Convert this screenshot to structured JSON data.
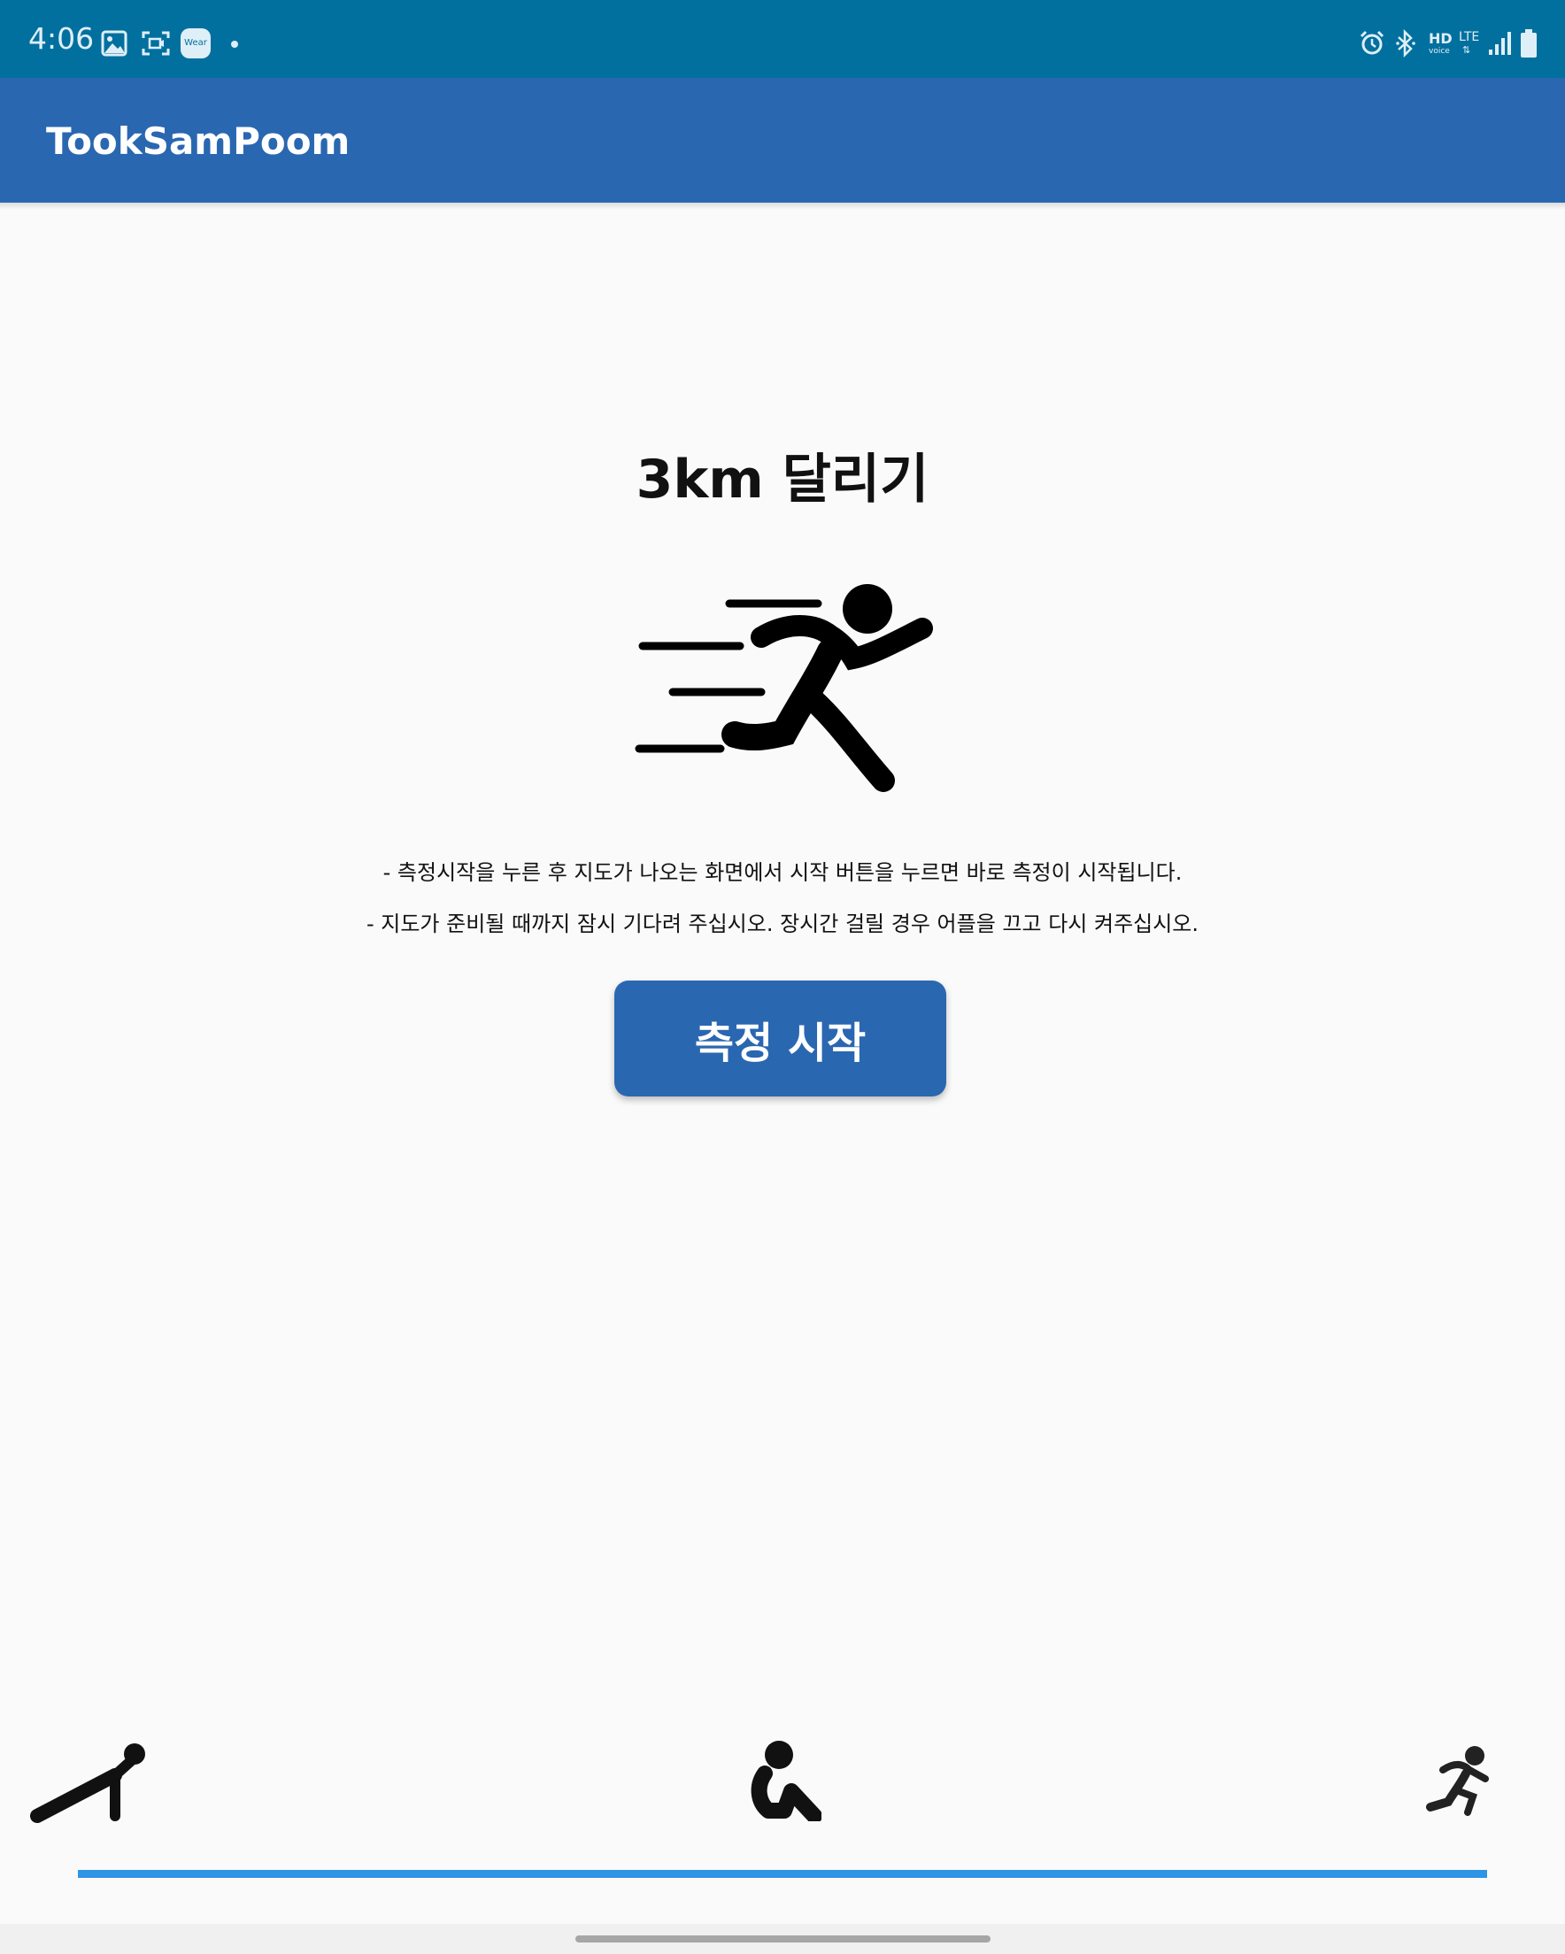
{
  "status_bar": {
    "time": "4:06",
    "left_icons": [
      "gallery-icon",
      "screen-capture-icon",
      "wear-icon",
      "dot-icon"
    ],
    "wear_label": "Wear",
    "right_icons": [
      "alarm-icon",
      "bluetooth-icon",
      "hd-voice-lte-icon",
      "signal-icon",
      "battery-icon"
    ],
    "hd_label": "HD",
    "voice_label": "voice",
    "lte_label": "LTE"
  },
  "app_bar": {
    "title": "TookSamPoom"
  },
  "main": {
    "heading": "3km 달리기",
    "illustration": "running-person-icon",
    "instructions": [
      "- 측정시작을 누른 후 지도가 나오는 화면에서 시작 버튼을 누르면 바로 측정이 시작됩니다.",
      "- 지도가 준비될 때까지 잠시 기다려 주십시오. 장시간 걸릴 경우 어플을 끄고 다시 켜주십시오."
    ],
    "start_button_label": "측정 시작"
  },
  "bottom_tabs": {
    "items": [
      {
        "icon": "pushup-icon"
      },
      {
        "icon": "situp-icon"
      },
      {
        "icon": "running-icon",
        "selected": true
      }
    ]
  },
  "colors": {
    "status_bar": "#02709f",
    "app_bar": "#2a67b1",
    "button": "#2a67b1",
    "tab_indicator": "#2e94e4",
    "background": "#fafafa"
  }
}
